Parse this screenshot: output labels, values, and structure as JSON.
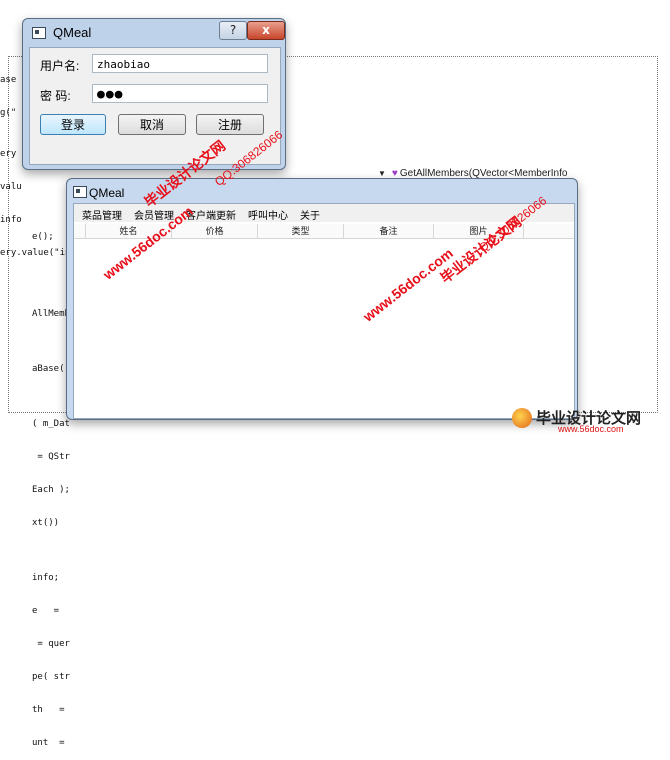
{
  "background_code": {
    "top_lines": [
      "ase",
      "g(\""
    ],
    "mid_lines": [
      "ery",
      "valu",
      "info",
      "ery.value(\"inAppTime\").toString();"
    ],
    "lower_lines": [
      "e();",
      "",
      "",
      "AllMembe",
      "",
      "aBase()",
      "",
      "( m_Dat",
      " = QStr",
      "Each );",
      "xt())",
      "",
      "info;",
      "e   =",
      " = quer",
      "pe( str",
      "th   =",
      "unt  ="
    ]
  },
  "ide_line": {
    "text": "GetAllMembers(QVector<MemberInfo"
  },
  "login_dialog": {
    "title": "QMeal",
    "help": "?",
    "close": "x",
    "username_label": "用户名:",
    "username_value": "zhaobiao",
    "password_label": "密  码:",
    "password_value": "●●●",
    "login_button": "登录",
    "cancel_button": "取消",
    "register_button": "注册"
  },
  "main_window": {
    "title": "QMeal",
    "menu": [
      "菜品管理",
      "会员管理",
      "客户端更新",
      "呼叫中心",
      "关于"
    ],
    "columns": [
      "姓名",
      "价格",
      "类型",
      "备注",
      "图片"
    ]
  },
  "watermarks": {
    "site_cn": "毕业设计论文网",
    "site_url": "www.56doc.com",
    "qq": "QQ:306826066"
  },
  "footer_logo": {
    "name": "毕业设计论文网",
    "url": "www.56doc.com"
  },
  "colors": {
    "watermark_red": "#e8101a",
    "watermark_blue": "#2a46c8",
    "titlebar": "#bed3ea"
  }
}
